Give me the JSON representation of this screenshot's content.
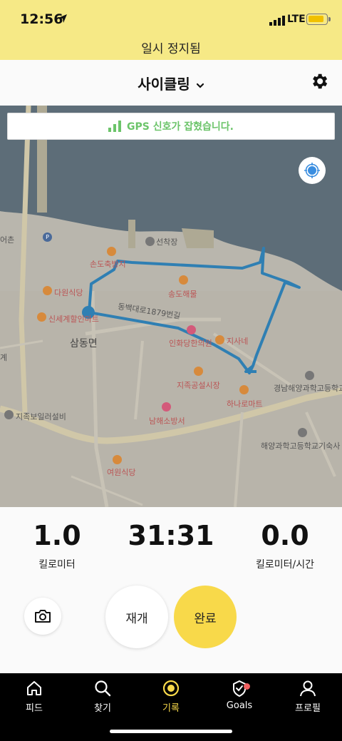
{
  "status": {
    "time": "12:56",
    "network": "LTE"
  },
  "banner": {
    "paused_text": "일시 정지됨"
  },
  "header": {
    "activity": "사이클링"
  },
  "map": {
    "gps_status": "GPS 신호가 잡혔습니다.",
    "labels": {
      "chon": "어촌",
      "parking": "P",
      "seonchakjang": "선착장",
      "sondochuk": "손도축방지",
      "dawonsikdang": "다원식당",
      "songdohaemul": "송도해물",
      "sinsegye": "신세계할인마트",
      "dongbaek": "동백대로1879번길",
      "samdongmyeon": "삼동면",
      "inhwadang": "인화당한의원",
      "sahoe": "지사네",
      "jijokgongseol": "지족공설시장",
      "hanaro": "하나로마트",
      "gyeongnam": "경남해양과학고등학교",
      "gye": "계",
      "jijokboil": "지족보일러설비",
      "namhaesobang": "남해소방서",
      "haeyang_dorm": "해양과학고등학교기숙사",
      "yeowon": "여원식당"
    }
  },
  "stats": {
    "distance_value": "1.0",
    "distance_label": "킬로미터",
    "time_value": "31:31",
    "speed_value": "0.0",
    "speed_label": "킬로미터/시간"
  },
  "buttons": {
    "resume": "재개",
    "finish": "완료"
  },
  "tabs": [
    {
      "label": "피드",
      "icon": "home-icon"
    },
    {
      "label": "찾기",
      "icon": "search-icon"
    },
    {
      "label": "기록",
      "icon": "record-icon"
    },
    {
      "label": "Goals",
      "icon": "goals-icon"
    },
    {
      "label": "프로필",
      "icon": "profile-icon"
    }
  ],
  "colors": {
    "accent": "#f8d94a",
    "route": "#2f7fb3",
    "gps_ok": "#6cc46a",
    "banner": "#f6e986"
  }
}
